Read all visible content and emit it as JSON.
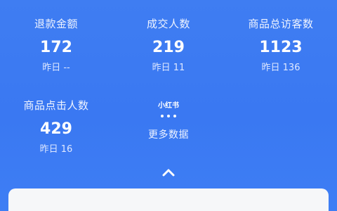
{
  "stats": [
    {
      "label": "退款金额",
      "value": "172",
      "sub": "昨日 --"
    },
    {
      "label": "成交人数",
      "value": "219",
      "sub": "昨日 11"
    },
    {
      "label": "商品总访客数",
      "value": "1123",
      "sub": "昨日 136"
    },
    {
      "label": "商品点击人数",
      "value": "429",
      "sub": "昨日 16"
    }
  ],
  "more": {
    "brand": "小红书",
    "label": "更多数据"
  },
  "icons": {
    "collapse": "chevron-up-icon",
    "more_dots": "more-dots-icon"
  },
  "colors": {
    "background": "#3a78f2",
    "text": "#ffffff",
    "card": "#f6f7f9"
  }
}
